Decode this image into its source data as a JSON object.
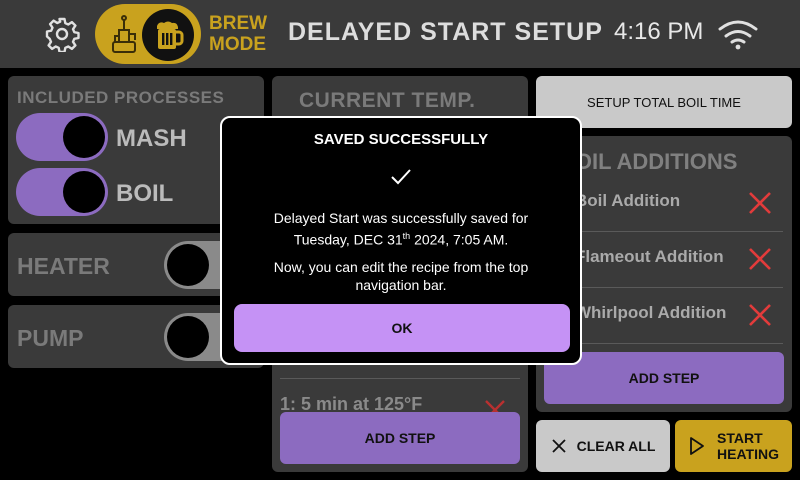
{
  "header": {
    "mode_label_line1": "BREW",
    "mode_label_line2": "MODE",
    "title": "DELAYED START SETUP",
    "time": "4:16 PM"
  },
  "processes": {
    "title": "INCLUDED PROCESSES",
    "items": [
      {
        "label": "MASH",
        "state": "on"
      },
      {
        "label": "BOIL",
        "state": "on"
      }
    ]
  },
  "heater": {
    "label": "HEATER",
    "state": "off"
  },
  "pump": {
    "label": "PUMP",
    "state": "off"
  },
  "center": {
    "title": "CURRENT TEMP.",
    "step_partial": "1: 5 min at 125°F",
    "add_step_label": "ADD STEP"
  },
  "right": {
    "setup_boil_time_label": "SETUP TOTAL BOIL TIME",
    "additions_title": "BOIL ADDITIONS",
    "additions": [
      {
        "name": "Boil Addition"
      },
      {
        "name": "Flameout Addition"
      },
      {
        "name": "Whirlpool Addition"
      }
    ],
    "add_step_label": "ADD STEP",
    "clear_all_label": "CLEAR ALL",
    "start_heating_line1": "START",
    "start_heating_line2": "HEATING"
  },
  "modal": {
    "title": "SAVED SUCCESSFULLY",
    "msg_line1": "Delayed Start was successfully saved for",
    "msg_date_pre": "Tuesday, DEC 31",
    "msg_date_sup": "th",
    "msg_date_post": " 2024, 7:05 AM.",
    "msg2": "Now, you can edit the recipe from the top navigation bar.",
    "ok_label": "OK"
  },
  "colors": {
    "accent_purple": "#8c6bc0",
    "modal_button": "#c592f5",
    "brew_gold": "#c9a21e",
    "delete_red": "#e23b3b"
  }
}
